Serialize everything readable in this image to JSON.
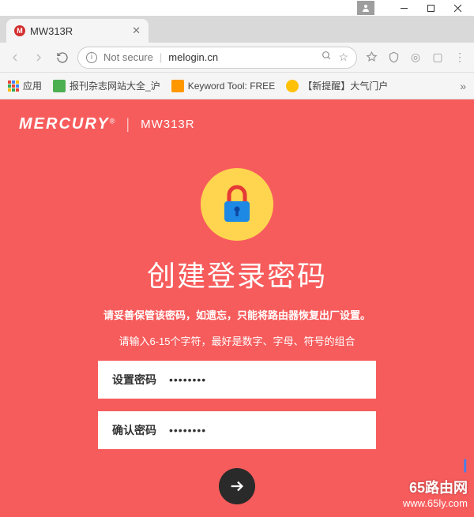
{
  "browser": {
    "tab": {
      "title": "MW313R"
    },
    "address": {
      "not_secure": "Not secure",
      "url": "melogin.cn"
    },
    "bookmarks": {
      "apps": "应用",
      "b1": "报刊杂志网站大全_沪",
      "b2": "Keyword Tool: FREE",
      "b3": "【新提醒】大气门户"
    }
  },
  "page": {
    "brand": {
      "name": "MERCURY",
      "reg": "®",
      "model": "MW313R"
    },
    "title": "创建登录密码",
    "note": "请妥善保管该密码，如遗忘，只能将路由器恢复出厂设置。",
    "hint": "请输入6-15个字符，最好是数字、字母、符号的组合",
    "field1": {
      "label": "设置密码",
      "value": "••••••••"
    },
    "field2": {
      "label": "确认密码",
      "value": "••••••••"
    }
  },
  "watermark": {
    "line1": "Ⅰ",
    "line2": "65路由网",
    "line3": "www.65ly.com"
  }
}
